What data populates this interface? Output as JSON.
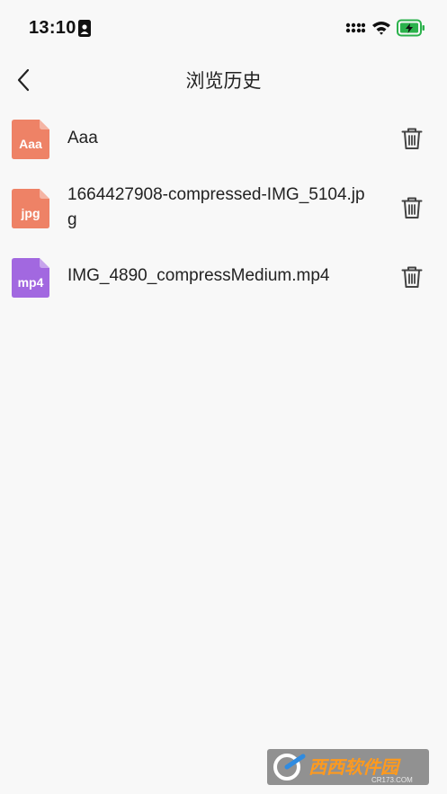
{
  "status_bar": {
    "time": "13:10"
  },
  "nav": {
    "title": "浏览历史"
  },
  "files": [
    {
      "ext_label": "Aaa",
      "name": "Aaa",
      "color": "#ee8266"
    },
    {
      "ext_label": "jpg",
      "name": "1664427908-compressed-IMG_5104.jpg",
      "color": "#ee8266"
    },
    {
      "ext_label": "mp4",
      "name": "IMG_4890_compressMedium.mp4",
      "color": "#a268e0"
    }
  ],
  "watermark": {
    "text": "西西软件园",
    "subtext": "CR173.COM"
  }
}
